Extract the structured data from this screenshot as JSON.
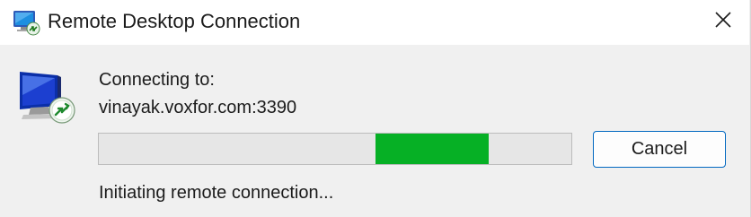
{
  "window": {
    "title": "Remote Desktop Connection",
    "app_icon": "remote-desktop-icon",
    "close_icon": "close-icon"
  },
  "main": {
    "connecting_label": "Connecting to:",
    "host": "vinayak.voxfor.com:3390",
    "progress": {
      "state": "indeterminate",
      "fill_color": "#06b025"
    },
    "status": "Initiating remote connection...",
    "cancel_label": "Cancel"
  },
  "colors": {
    "progress_green": "#06b025",
    "button_border": "#0067c0"
  }
}
